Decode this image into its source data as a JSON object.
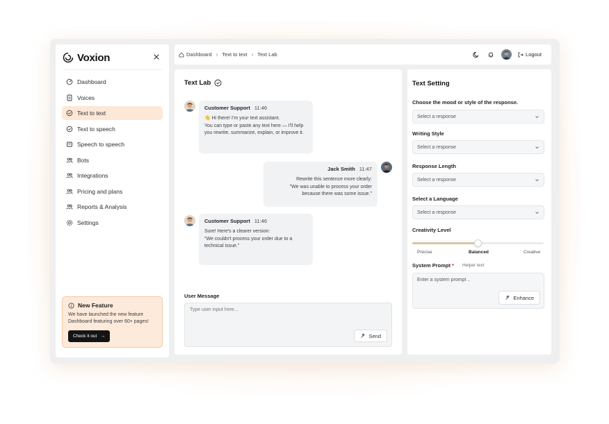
{
  "brand": {
    "name": "Voxion"
  },
  "sidebar": {
    "items": [
      {
        "label": "Dashboard",
        "icon": "dashboard-icon",
        "active": false
      },
      {
        "label": "Voices",
        "icon": "voices-icon",
        "active": false
      },
      {
        "label": "Text to text",
        "icon": "check-circle-icon",
        "active": true
      },
      {
        "label": "Text to speech",
        "icon": "check-circle-icon",
        "active": false
      },
      {
        "label": "Speech to speech",
        "icon": "speech-icon",
        "active": false
      },
      {
        "label": "Bots",
        "icon": "users-icon",
        "active": false
      },
      {
        "label": "Integrations",
        "icon": "users-icon",
        "active": false
      },
      {
        "label": "Pricing and plans",
        "icon": "users-icon",
        "active": false
      },
      {
        "label": "Reports & Analysis",
        "icon": "users-icon",
        "active": false
      },
      {
        "label": "Settings",
        "icon": "gear-icon",
        "active": false
      }
    ],
    "feature": {
      "title": "New Feature",
      "text": "We have launched the new feature Dashboard featuring over 60+ pages!",
      "button": "Check it out"
    }
  },
  "breadcrumb": [
    "Dashboard",
    "Text to text",
    "Text Lab"
  ],
  "topbar": {
    "logout": "Logout"
  },
  "chat": {
    "title": "Text Lab",
    "messages": [
      {
        "sender": "Customer Support",
        "time": "11:46",
        "side": "left",
        "text": "👋 Hi there! I'm your text assistant.\n You can type or paste any text here — I'll help you rewrite, summarize, explain, or improve it."
      },
      {
        "sender": "Jack Smith",
        "time": "11:47",
        "side": "right",
        "text": "Rewrite this sentence more clearly:\n\"We was unable to process your order\nbecause there was some issue.\""
      },
      {
        "sender": "Customer Support",
        "time": "11:46",
        "side": "left",
        "text": "Sure! Here's a clearer version:\n \"We couldn't process your order due to a technical issue.\""
      }
    ],
    "user_message_label": "User Message",
    "input_placeholder": "Type user input here...",
    "send": "Send"
  },
  "settings": {
    "title": "Text Setting",
    "fields": [
      {
        "label": "Choose the mood or style of the response.",
        "value": "Select a response"
      },
      {
        "label": "Writing Style",
        "value": "Select a response"
      },
      {
        "label": "Response Length",
        "value": "Select a response"
      },
      {
        "label": "Select a Language",
        "value": "Select a response"
      }
    ],
    "creativity": {
      "label": "Creativity Level",
      "level": 0.5,
      "scale": [
        "Precise",
        "Balanced",
        "Creative"
      ]
    },
    "system_prompt": {
      "label": "System Prompt",
      "required": "*",
      "helper": "Helper text",
      "placeholder": "Enter a system prompt ..",
      "enhance": "Enhance"
    }
  },
  "colors": {
    "accent_bg": "#fde7d6",
    "accent_border": "#f4c8a4",
    "slider_fill": "#dcc3a6",
    "button_dark": "#141414"
  }
}
